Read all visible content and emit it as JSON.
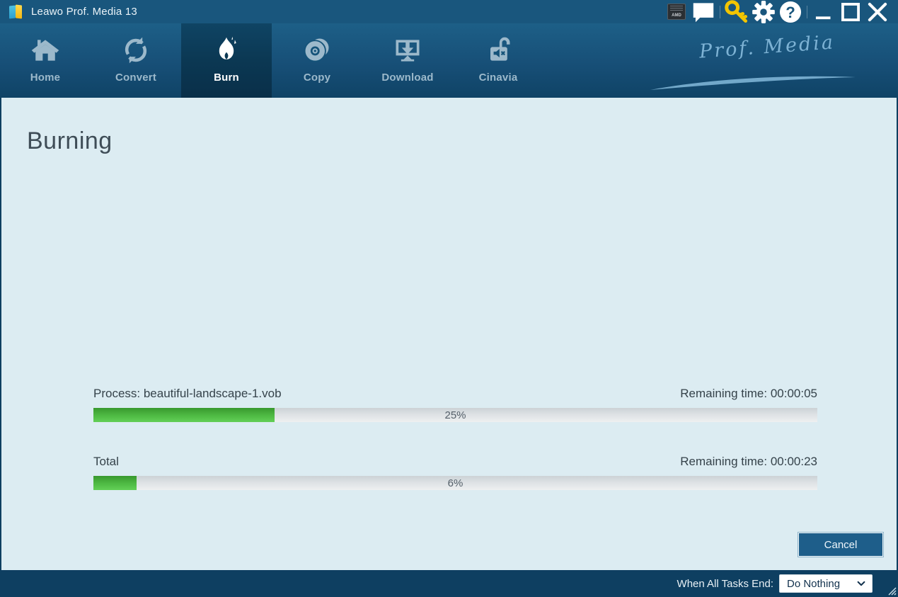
{
  "window": {
    "title": "Leawo Prof. Media 13"
  },
  "titlebar": {
    "amd_badge_text": "AMD",
    "icons": [
      "amd-tray",
      "feedback-bubble",
      "register-key",
      "settings-gear",
      "help",
      "minimize",
      "maximize",
      "close"
    ]
  },
  "nav": {
    "tabs": [
      {
        "label": "Home",
        "active": false
      },
      {
        "label": "Convert",
        "active": false
      },
      {
        "label": "Burn",
        "active": true
      },
      {
        "label": "Copy",
        "active": false
      },
      {
        "label": "Download",
        "active": false
      },
      {
        "label": "Cinavia",
        "active": false
      }
    ],
    "brand": "Prof. Media"
  },
  "page": {
    "title": "Burning"
  },
  "tasks": [
    {
      "label": "Process: beautiful-landscape-1.vob",
      "remaining": "Remaining time: 00:00:05",
      "percent": 25,
      "percent_label": "25%"
    },
    {
      "label": "Total",
      "remaining": "Remaining time: 00:00:23",
      "percent": 6,
      "percent_label": "6%"
    }
  ],
  "footer": {
    "cancel_label": "Cancel",
    "when_all_tasks_end_label": "When All Tasks End:",
    "selected_option": "Do Nothing"
  },
  "colors": {
    "titlebar_blue": "#19567d",
    "active_tab_navy": "#0b3853",
    "content_bg": "#dcecf2",
    "progress_green": "#4fbb44",
    "footer_navy": "#0e3f61",
    "key_yellow": "#f2c500"
  }
}
